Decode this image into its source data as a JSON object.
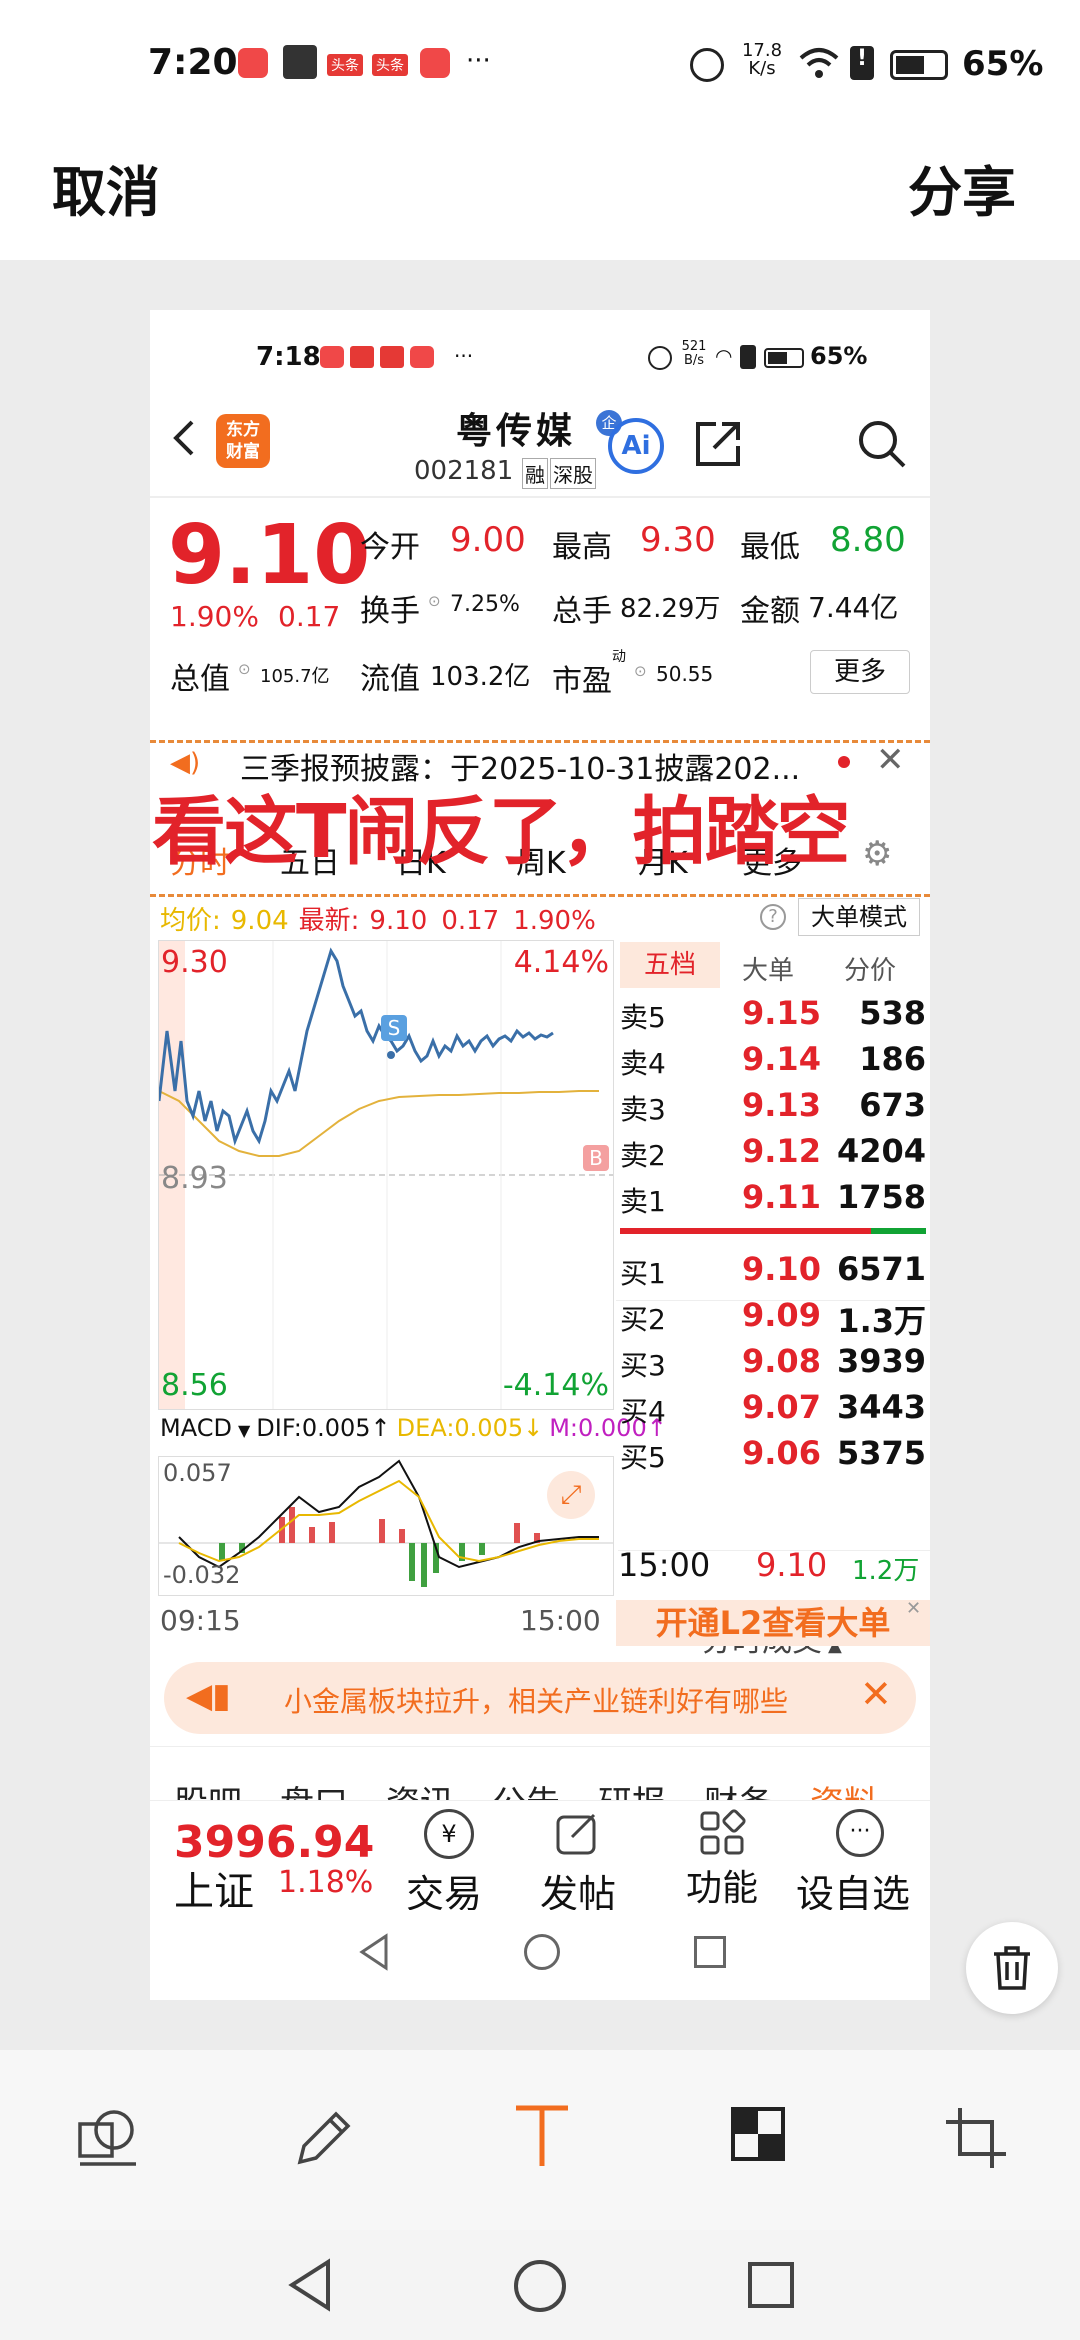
{
  "status": {
    "time": "7:20",
    "speed_top": "17.8",
    "speed_unit": "K/s",
    "battery": "65%",
    "more": "···",
    "app_small1": "头条",
    "app_small2": "头条"
  },
  "top": {
    "cancel": "取消",
    "share": "分享"
  },
  "inner": {
    "status": {
      "time": "7:18",
      "speed_top": "521",
      "speed_unit": "B/s",
      "battery": "65%",
      "more": "···"
    },
    "brand": "东方\n财富",
    "stock_name": "粤传媒",
    "stock_code": "002181",
    "tag_rong": "融",
    "tag_market": "深股",
    "ai_label": "Ai",
    "quote": {
      "price": "9.10",
      "pct": "1.90%",
      "chg": "0.17",
      "open_l": "今开",
      "open": "9.00",
      "high_l": "最高",
      "high": "9.30",
      "low_l": "最低",
      "low": "8.80",
      "turn_l": "换手",
      "turn": "7.25%",
      "vol_l": "总手",
      "vol": "82.29万",
      "amt_l": "金额",
      "amt": "7.44亿",
      "mcap_l": "总值",
      "mcap": "105.7亿",
      "fcap_l": "流值",
      "fcap": "103.2亿",
      "pe_l": "市盈",
      "pe_sup": "动",
      "pe": "50.55",
      "more": "更多"
    },
    "notice": "三季报预披露：于2025-10-31披露202...",
    "overlay": "看这T闹反了，拍踏空",
    "tabs": [
      "分时",
      "五日",
      "日K",
      "周K",
      "月K",
      "更多"
    ],
    "avg_line": {
      "avg_l": "均价:",
      "avg": "9.04",
      "new_l": "最新:",
      "new": "9.10",
      "chg": "0.17",
      "pct": "1.90%",
      "mode": "大单模式"
    },
    "chart": {
      "top_price": "9.30",
      "top_pct": "4.14%",
      "mid_price": "8.93",
      "bot_price": "8.56",
      "bot_pct": "-4.14%",
      "s_mark": "S",
      "b_mark": "B"
    },
    "macd": {
      "label": "MACD",
      "dif": "DIF:0.005↑",
      "dea": "DEA:0.005↓",
      "m": "M:0.000↑",
      "top": "0.057",
      "bot": "-0.032",
      "t_start": "09:15",
      "t_end": "15:00"
    },
    "book": {
      "tabs": [
        "五档",
        "大单",
        "分价"
      ],
      "sell": [
        {
          "l": "卖5",
          "p": "9.15",
          "v": "538"
        },
        {
          "l": "卖4",
          "p": "9.14",
          "v": "186"
        },
        {
          "l": "卖3",
          "p": "9.13",
          "v": "673"
        },
        {
          "l": "卖2",
          "p": "9.12",
          "v": "4204"
        },
        {
          "l": "卖1",
          "p": "9.11",
          "v": "1758"
        }
      ],
      "buy": [
        {
          "l": "买1",
          "p": "9.10",
          "v": "6571"
        },
        {
          "l": "买2",
          "p": "9.09",
          "v": "1.3万"
        },
        {
          "l": "买3",
          "p": "9.08",
          "v": "3939"
        },
        {
          "l": "买4",
          "p": "9.07",
          "v": "3443"
        },
        {
          "l": "买5",
          "p": "9.06",
          "v": "5375"
        }
      ],
      "trade_title": "分时成交",
      "trade": {
        "t": "15:00",
        "p": "9.10",
        "v": "1.2万"
      },
      "l2": "开通L2查看大单"
    },
    "banner": "小金属板块拉升，相关产业链利好有哪些",
    "subtabs": [
      "股吧",
      "盘口",
      "资讯",
      "公告",
      "研报",
      "财务",
      "资料"
    ],
    "index": {
      "value": "3996.94",
      "name": "上证",
      "pct": "1.18%"
    },
    "actions": [
      "交易",
      "发帖",
      "功能",
      "设自选"
    ]
  },
  "colors": {
    "red": "#e2232a",
    "green": "#11a334",
    "orange": "#f08c2a",
    "accent": "#f26d1f"
  }
}
